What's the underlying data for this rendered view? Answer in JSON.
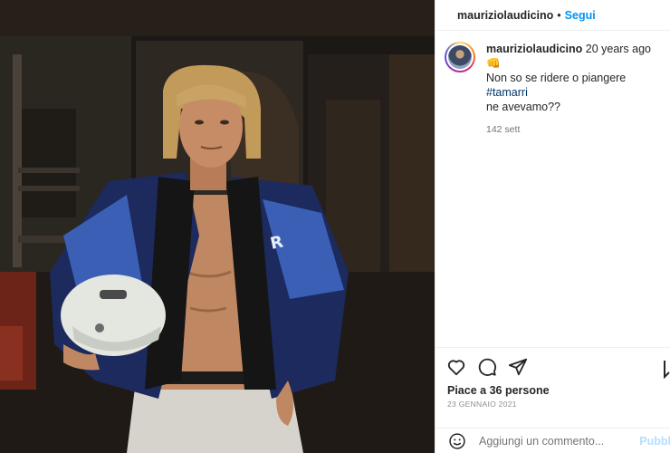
{
  "post": {
    "username": "mauriziolaudicino",
    "separator": "•",
    "follow_label": "Segui"
  },
  "caption": {
    "username": "mauriziolaudicino",
    "text_1": " 20 years ago 👊",
    "text_2": "Non so se ridere o piangere ",
    "hashtag": "#tamarri",
    "text_3": "ne avevamo??",
    "meta": "142 sett"
  },
  "engagement": {
    "likes_label": "Piace a 36 persone",
    "date_label": "23 GENNAIO 2021"
  },
  "comment": {
    "placeholder": "Aggiungi un commento...",
    "post_label": "Pubbl"
  },
  "icons": {
    "like": "heart-icon",
    "comment": "comment-icon",
    "share": "share-icon",
    "save": "bookmark-icon",
    "emoji": "emoji-icon"
  },
  "colors": {
    "accent": "#0095f6",
    "hashtag": "#00376b",
    "muted": "#737373"
  }
}
